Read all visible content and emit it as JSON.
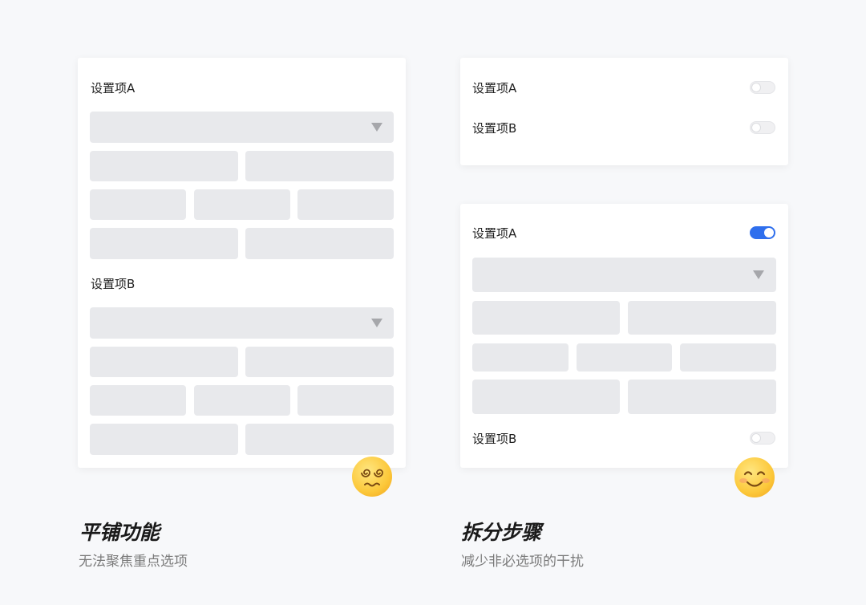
{
  "left_panel": {
    "setting_a_label": "设置项A",
    "setting_b_label": "设置项B",
    "caption_title": "平铺功能",
    "caption_subtitle": "无法聚焦重点选项",
    "emoji": "dizzy-face-icon"
  },
  "right_panel": {
    "collapsed": {
      "setting_a_label": "设置项A",
      "setting_b_label": "设置项B",
      "setting_a_enabled": false,
      "setting_b_enabled": false
    },
    "expanded": {
      "setting_a_label": "设置项A",
      "setting_b_label": "设置项B",
      "setting_a_enabled": true,
      "setting_b_enabled": false
    },
    "caption_title": "拆分步骤",
    "caption_subtitle": "减少非必选项的干扰",
    "emoji": "smiling-face-icon"
  },
  "colors": {
    "background": "#f7f8fa",
    "placeholder": "#e8e9ec",
    "toggle_on": "#2f6fed"
  }
}
